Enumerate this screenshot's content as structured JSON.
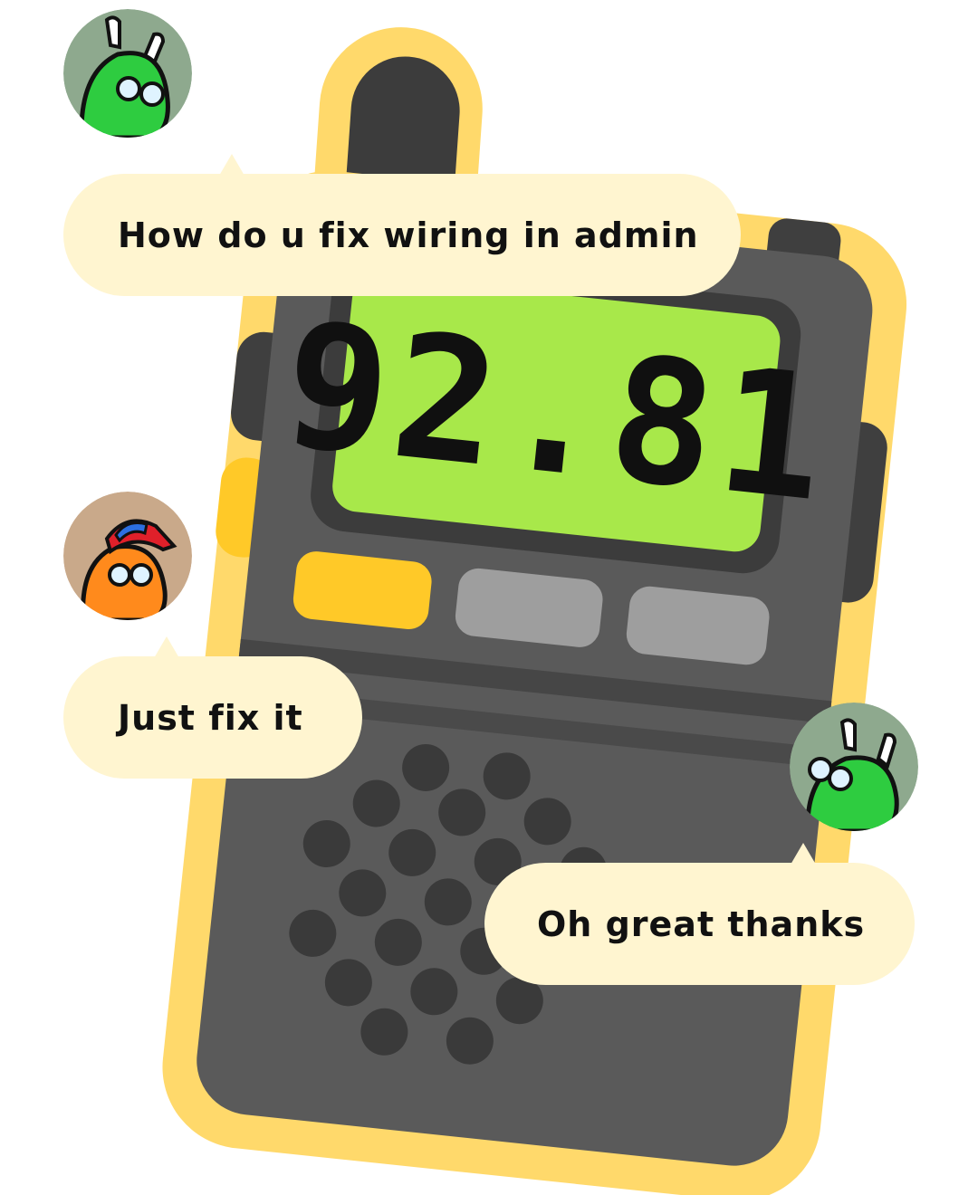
{
  "radio": {
    "frequency": "92.81"
  },
  "messages": [
    {
      "text": "How do u fix wiring in admin",
      "avatar": "green-bunny-crewmate-with-glasses",
      "avatar_bg": "#8ea98e"
    },
    {
      "text": "Just fix it",
      "avatar": "orange-crewmate-with-cap",
      "avatar_bg": "#c9a98a"
    },
    {
      "text": "Oh great thanks",
      "avatar": "green-bunny-crewmate-with-glasses",
      "avatar_bg": "#8ea98e"
    }
  ],
  "colors": {
    "radio_outline": "#ffd96b",
    "radio_body": "#5a5a5a",
    "screen": "#a8e84a",
    "accent_button": "#ffc928",
    "bubble": "#fff5d0"
  }
}
